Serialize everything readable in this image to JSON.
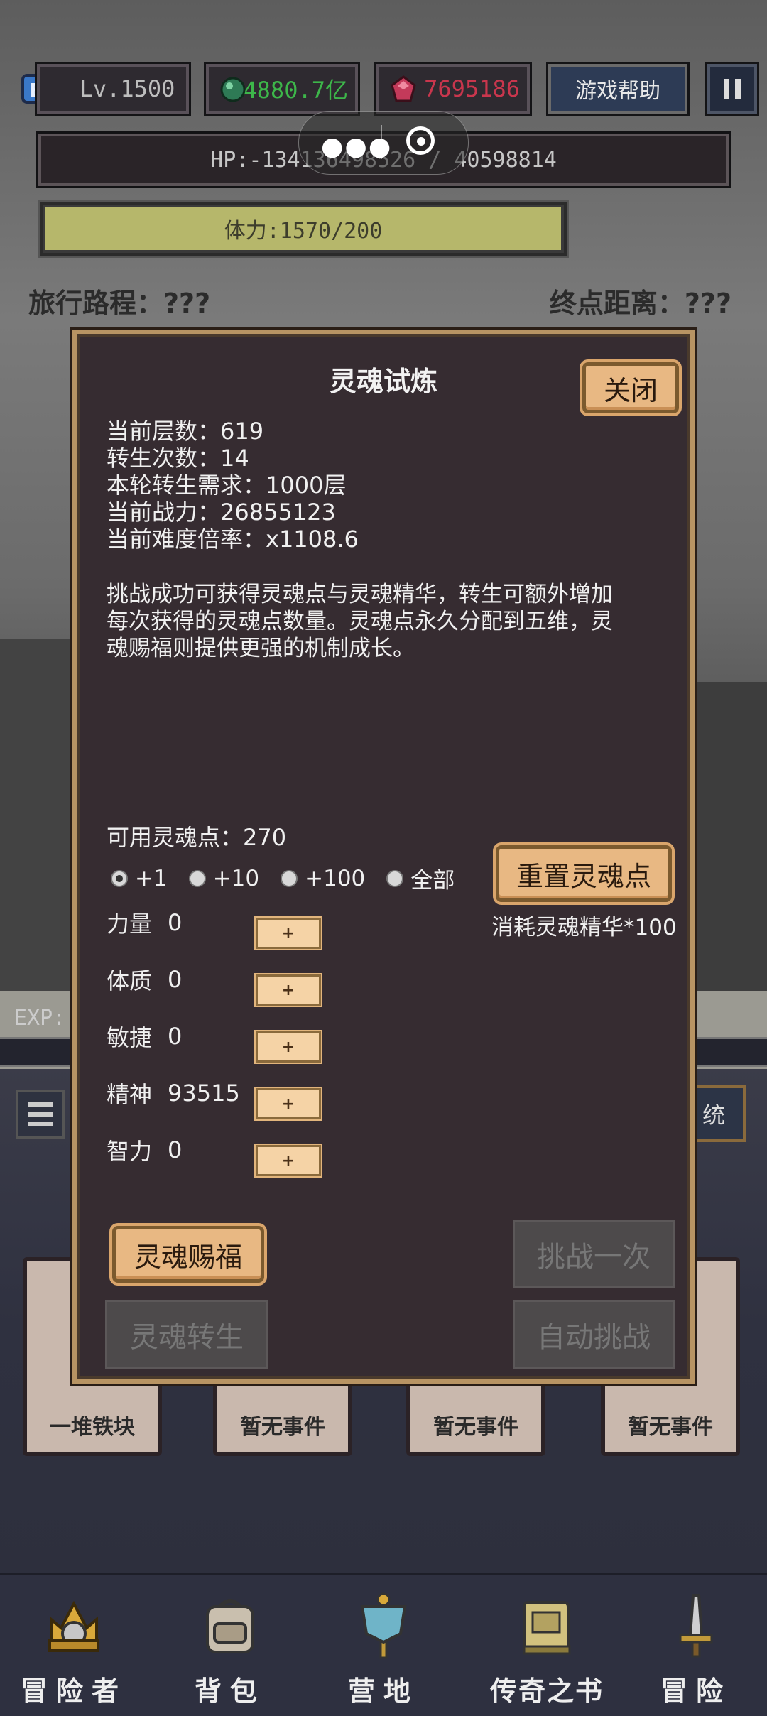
{
  "hud": {
    "exp_badge": "EXP",
    "level": "Lv.1500",
    "gems": "4880.7亿",
    "rubies": "7695186",
    "help_label": "游戏帮助",
    "hp": "HP:-134136498526 / 40598814",
    "stamina": "体力:1570/200",
    "stamina_fraction": 1.0,
    "route_label": "旅行路程：???",
    "distance_label": "终点距离：???"
  },
  "modal": {
    "title": "灵魂试炼",
    "close_label": "关闭",
    "stats": {
      "floor": "当前层数：619",
      "rebirths": "转生次数：14",
      "requirement": "本轮转生需求：1000层",
      "power": "当前战力：26855123",
      "difficulty": "当前难度倍率：x1108.6"
    },
    "description": "挑战成功可获得灵魂点与灵魂精华，转生可额外增加每次获得的灵魂点数量。灵魂点永久分配到五维，灵魂赐福则提供更强的机制成长。",
    "soul_points": "可用灵魂点：270",
    "increments": [
      "+1",
      "+10",
      "+100",
      "全部"
    ],
    "selected_increment": "+1",
    "reset_label": "重置灵魂点",
    "reset_cost": "消耗灵魂精华*100",
    "plus_label": "+",
    "attributes": [
      {
        "name": "力量",
        "value": "0"
      },
      {
        "name": "体质",
        "value": "0"
      },
      {
        "name": "敏捷",
        "value": "0"
      },
      {
        "name": "精神",
        "value": "93515"
      },
      {
        "name": "智力",
        "value": "0"
      }
    ],
    "blessing_label": "灵魂赐福",
    "challenge_once_label": "挑战一次",
    "rebirth_label": "灵魂转生",
    "auto_challenge_label": "自动挑战"
  },
  "background": {
    "exp_label": "EXP:",
    "system_label": "统",
    "cards": [
      "一堆铁块",
      "暂无事件",
      "暂无事件",
      "暂无事件"
    ]
  },
  "nav": {
    "items": [
      "冒险者",
      "背包",
      "营地",
      "传奇之书",
      "冒险"
    ]
  },
  "colors": {
    "gem_green": "#3db64a",
    "ruby_red": "#c9364d",
    "modal_bg": "#362c31",
    "button_tan": "#e8b883"
  }
}
